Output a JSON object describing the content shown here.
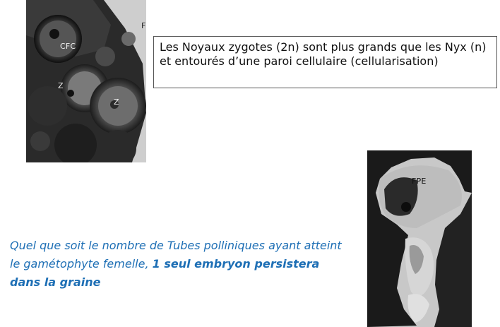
{
  "figure_top": {
    "labels": {
      "cfc": "CFC",
      "z": "Z",
      "z2": "Z",
      "fe": "F"
    }
  },
  "figure_bottom": {
    "labels": {
      "fpe": "FPE"
    }
  },
  "note": {
    "text": "Les Noyaux zygotes (2n) sont plus grands que les Nyx (n) et entourés d’une paroi cellulaire (cellularisation)"
  },
  "caption": {
    "plain": "Quel que soit le nombre de Tubes polliniques ayant atteint le gamétophyte femelle, ",
    "bold": "1 seul embryon persistera dans la graine"
  }
}
